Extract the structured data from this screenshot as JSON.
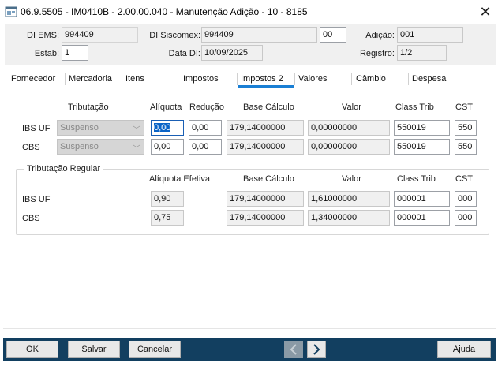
{
  "window": {
    "title": "06.9.5505 - IM0410B - 2.00.00.040 - Manutenção Adição - 10 - 8185",
    "close_glyph": "✕"
  },
  "header": {
    "di_ems_label": "DI EMS:",
    "di_ems_value": "994409",
    "di_siscomex_label": "DI Siscomex:",
    "di_siscomex_value": "994409",
    "di_siscomex_suffix": "00",
    "adicao_label": "Adição:",
    "adicao_value": "001",
    "estab_label": "Estab:",
    "estab_value": "1",
    "data_di_label": "Data DI:",
    "data_di_value": "10/09/2025",
    "registro_label": "Registro:",
    "registro_value": "1/2"
  },
  "tabs": [
    {
      "label": "Fornecedor"
    },
    {
      "label": "Mercadoria"
    },
    {
      "label": "Itens"
    },
    {
      "label": "Impostos"
    },
    {
      "label": "Impostos 2",
      "active": true
    },
    {
      "label": "Valores"
    },
    {
      "label": "Câmbio"
    },
    {
      "label": "Despesa"
    }
  ],
  "section1": {
    "headers": {
      "tributacao": "Tributação",
      "aliquota": "Alíquota",
      "reducao": "Redução",
      "base_calculo": "Base Cálculo",
      "valor": "Valor",
      "class_trib": "Class Trib",
      "cst": "CST"
    },
    "rows": [
      {
        "label": "IBS UF",
        "tributacao": "Suspenso",
        "aliquota": "0,00",
        "reducao": "0,00",
        "base_calculo": "179,14000000",
        "valor": "0,00000000",
        "class_trib": "550019",
        "cst": "550"
      },
      {
        "label": "CBS",
        "tributacao": "Suspenso",
        "aliquota": "0,00",
        "reducao": "0,00",
        "base_calculo": "179,14000000",
        "valor": "0,00000000",
        "class_trib": "550019",
        "cst": "550"
      }
    ]
  },
  "section2": {
    "title": "Tributação Regular",
    "headers": {
      "aliquota_efetiva": "Alíquota Efetiva",
      "base_calculo": "Base Cálculo",
      "valor": "Valor",
      "class_trib": "Class Trib",
      "cst": "CST"
    },
    "rows": [
      {
        "label": "IBS UF",
        "aliquota_efetiva": "0,90",
        "base_calculo": "179,14000000",
        "valor": "1,61000000",
        "class_trib": "000001",
        "cst": "000"
      },
      {
        "label": "CBS",
        "aliquota_efetiva": "0,75",
        "base_calculo": "179,14000000",
        "valor": "1,34000000",
        "class_trib": "000001",
        "cst": "000"
      }
    ]
  },
  "footer": {
    "ok_label": "OK",
    "salvar_label": "Salvar",
    "cancelar_label": "Cancelar",
    "ajuda_label": "Ajuda"
  },
  "colors": {
    "footer_bg": "#123f60",
    "active_tab_accent": "#1a7fd4",
    "focus_highlight": "#0a64c8"
  }
}
